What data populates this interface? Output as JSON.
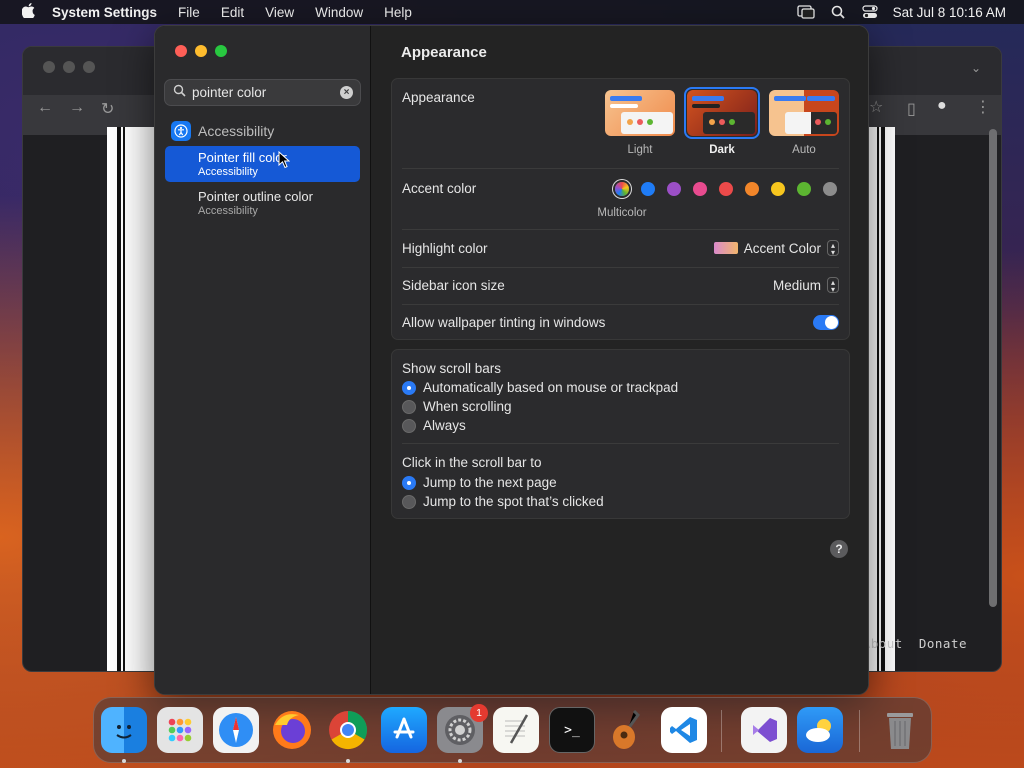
{
  "menubar": {
    "app_name": "System Settings",
    "items": [
      "File",
      "Edit",
      "View",
      "Window",
      "Help"
    ],
    "clock": "Sat Jul 8  10:16 AM"
  },
  "browser": {
    "footer_links": [
      "About",
      "Donate"
    ]
  },
  "sidebar": {
    "search": {
      "value": "pointer color",
      "placeholder": "Search"
    },
    "group_label": "Accessibility",
    "results": [
      {
        "title": "Pointer fill color",
        "subtitle": "Accessibility",
        "selected": true
      },
      {
        "title": "Pointer outline color",
        "subtitle": "Accessibility",
        "selected": false
      }
    ]
  },
  "content": {
    "title": "Appearance",
    "appearance": {
      "label": "Appearance",
      "options": [
        {
          "label": "Light",
          "selected": false
        },
        {
          "label": "Dark",
          "selected": true
        },
        {
          "label": "Auto",
          "selected": false
        }
      ]
    },
    "accent": {
      "label": "Accent color",
      "selected_caption": "Multicolor",
      "colors": [
        "multicolor",
        "#1f7cf6",
        "#9b4fc6",
        "#e84b8f",
        "#ec4a4a",
        "#f2862a",
        "#f7c61e",
        "#5cb531",
        "#8c8c8c"
      ]
    },
    "highlight": {
      "label": "Highlight color",
      "value": "Accent Color"
    },
    "sidebar_icon": {
      "label": "Sidebar icon size",
      "value": "Medium"
    },
    "tinting": {
      "label": "Allow wallpaper tinting in windows",
      "enabled": true
    },
    "scroll_bars": {
      "label": "Show scroll bars",
      "options": [
        {
          "label": "Automatically based on mouse or trackpad",
          "selected": true
        },
        {
          "label": "When scrolling",
          "selected": false
        },
        {
          "label": "Always",
          "selected": false
        }
      ]
    },
    "click_scroll": {
      "label": "Click in the scroll bar to",
      "options": [
        {
          "label": "Jump to the next page",
          "selected": true
        },
        {
          "label": "Jump to the spot that’s clicked",
          "selected": false
        }
      ]
    },
    "help": "?"
  },
  "dock": {
    "apps": [
      "finder-icon",
      "launchpad-icon",
      "safari-icon",
      "firefox-icon",
      "chrome-icon",
      "app-store-icon",
      "system-settings-icon",
      "textedit-icon",
      "terminal-icon",
      "garageband-icon",
      "vscode-icon",
      "visual-studio-icon",
      "weather-icon",
      "trash-icon"
    ],
    "settings_badge": "1"
  }
}
